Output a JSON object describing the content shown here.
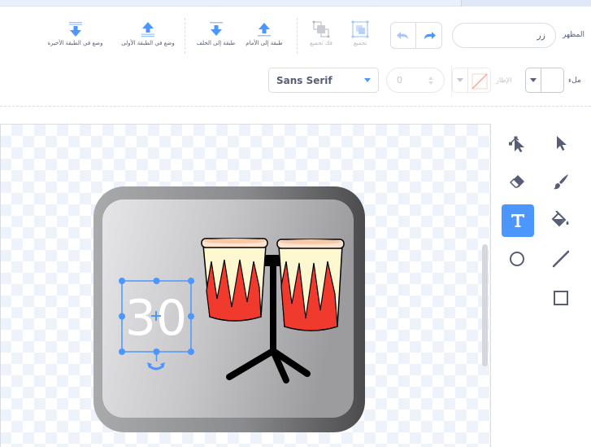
{
  "header": {
    "costume_label": "المظهر",
    "costume_name": "زر"
  },
  "arrange": {
    "group_label": "تجميع",
    "ungroup_label": "فك تجميع",
    "forward_label": "طبقة إلى الأمام",
    "backward_label": "طبقة إلى الخلف",
    "front_label": "وضع في الطبقة الأولى",
    "back_label": "وضع في الطبقة الأخيرة"
  },
  "style_bar": {
    "fill_label": "ملء",
    "outline_label": "الإطار",
    "stroke_width": "0",
    "font": "Sans Serif"
  },
  "canvas": {
    "text_object": "30"
  },
  "colors": {
    "accent": "#4c97ff",
    "text": "#575e75",
    "drum_red": "#f03a2e",
    "drum_cream": "#fef8d0"
  },
  "toolbox": {
    "icons": [
      "select-icon",
      "reshape-icon",
      "brush-icon",
      "eraser-icon",
      "fill-icon",
      "text-icon",
      "line-icon",
      "circle-icon",
      "rectangle-icon"
    ],
    "active": "text-icon"
  }
}
